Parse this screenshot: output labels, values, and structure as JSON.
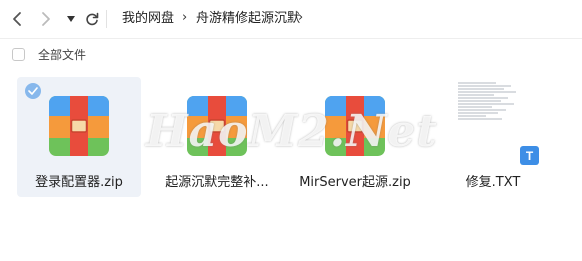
{
  "breadcrumb": {
    "root": "我的网盘",
    "current": "舟游精修起源沉默"
  },
  "select_all_label": "全部文件",
  "files": [
    {
      "name": "登录配置器.zip",
      "type": "zip",
      "selected": true
    },
    {
      "name": "起源沉默完整补...",
      "type": "zip",
      "selected": false
    },
    {
      "name": "MirServer起源.zip",
      "type": "zip",
      "selected": false
    },
    {
      "name": "修复.TXT",
      "type": "txt",
      "selected": false
    }
  ],
  "txt_badge": "T",
  "watermark": "HaoM2.Net",
  "colors": {
    "selected_bg": "#eef2f8",
    "check_badge": "#87b8ec",
    "zip_top_blue": "#4fa3f0",
    "zip_mid_orange": "#f59a3c",
    "zip_bottom_green": "#6ec25a",
    "zip_center_red": "#e84c3c",
    "txt_badge": "#3d8ee6"
  }
}
